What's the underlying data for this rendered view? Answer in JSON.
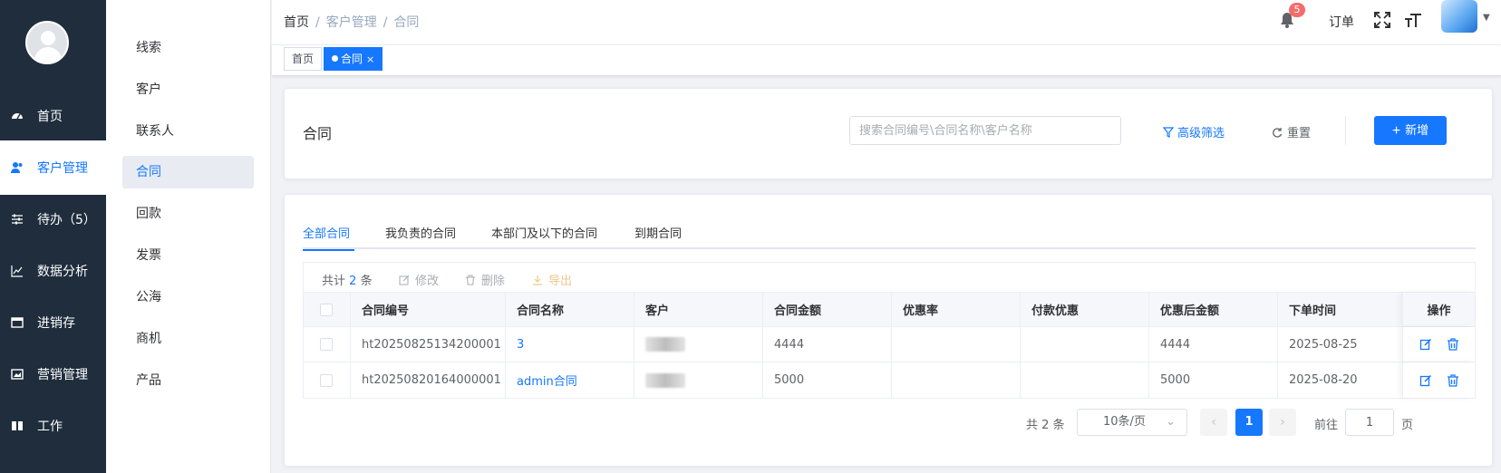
{
  "rail": {
    "items": [
      {
        "label": "首页",
        "icon": "dashboard-icon"
      },
      {
        "label": "客户管理",
        "icon": "users-icon"
      },
      {
        "label": "待办（5）",
        "icon": "sliders-icon"
      },
      {
        "label": "数据分析",
        "icon": "chart-icon"
      },
      {
        "label": "进销存",
        "icon": "card-icon"
      },
      {
        "label": "营销管理",
        "icon": "image-icon"
      },
      {
        "label": "工作",
        "icon": "book-icon"
      }
    ]
  },
  "submenu": {
    "items": [
      "线索",
      "客户",
      "联系人",
      "合同",
      "回款",
      "发票",
      "公海",
      "商机",
      "产品"
    ]
  },
  "header": {
    "breadcrumb": [
      "首页",
      "客户管理",
      "合同"
    ],
    "notifications": "5",
    "orders": "订单"
  },
  "tags": {
    "home": "首页",
    "current": "合同",
    "close": "×"
  },
  "top": {
    "title": "合同",
    "search_placeholder": "搜索合同编号\\合同名称\\客户名称",
    "advanced": "高级筛选",
    "reset": "重置",
    "add": "新增"
  },
  "tabs": [
    "全部合同",
    "我负责的合同",
    "本部门及以下的合同",
    "到期合同"
  ],
  "toolbar": {
    "count_prefix": "共计",
    "count": "2",
    "count_suffix": "条",
    "edit": "修改",
    "delete": "删除",
    "export": "导出"
  },
  "table": {
    "columns": [
      "合同编号",
      "合同名称",
      "客户",
      "合同金额",
      "优惠率",
      "付款优惠",
      "优惠后金额",
      "下单时间",
      "操作"
    ],
    "rows": [
      {
        "no": "ht20250825134200001",
        "name": "3",
        "customer": "",
        "amount": "4444",
        "rate": "",
        "pay_discount": "",
        "final": "4444",
        "time": "2025-08-25"
      },
      {
        "no": "ht20250820164000001",
        "name": "admin合同",
        "customer": "",
        "amount": "5000",
        "rate": "",
        "pay_discount": "",
        "final": "5000",
        "time": "2025-08-20"
      }
    ]
  },
  "pagination": {
    "total": "共 2 条",
    "page_size": "10条/页",
    "current": "1",
    "goto_label": "前往",
    "goto_value": "1",
    "page_suffix": "页"
  },
  "colors": {
    "accent": "#1677ff",
    "rail_bg": "#1f2d3d",
    "badge": "#f56c6c"
  }
}
